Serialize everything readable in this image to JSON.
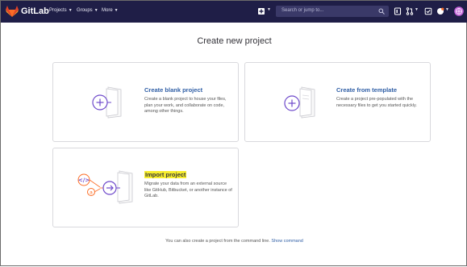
{
  "header": {
    "brand": "GitLab",
    "nav": [
      {
        "label": "Projects"
      },
      {
        "label": "Groups"
      },
      {
        "label": "More"
      }
    ],
    "search": {
      "placeholder": "Search or jump to..."
    }
  },
  "page": {
    "title": "Create new project"
  },
  "cards": {
    "blank": {
      "title": "Create blank project",
      "description": "Create a blank project to house your files, plan your work, and collaborate on code, among other things."
    },
    "template": {
      "title": "Create from template",
      "description": "Create a project pre-populated with the necessary files to get you started quickly."
    },
    "import": {
      "title": "Import project",
      "description": "Migrate your data from an external source like GitHub, Bitbucket, or another instance of GitLab."
    }
  },
  "footer": {
    "text": "You can also create a project from the command line.",
    "link": "Show command"
  },
  "colors": {
    "topbar": "#1f1e47",
    "accent_purple": "#6e49cb",
    "link": "#2f5ea5",
    "highlight": "#f7ee2e"
  }
}
